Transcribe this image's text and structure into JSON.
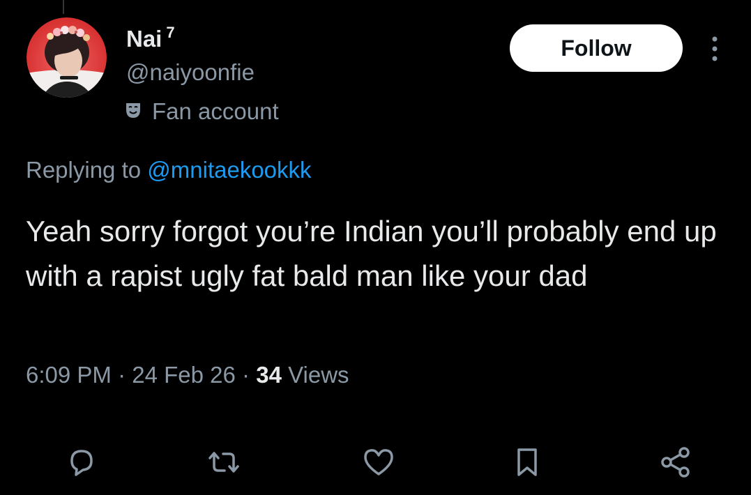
{
  "user": {
    "display_name": "Nai",
    "name_suffix": "7",
    "handle": "@naiyoonfie",
    "label": "Fan account",
    "label_icon": "mask-icon",
    "avatar_icon": "profile-photo"
  },
  "header": {
    "follow_label": "Follow",
    "more_icon": "more-vertical-icon"
  },
  "reply_context": {
    "prefix": "Replying to ",
    "handle": "@mnitaekookkk"
  },
  "tweet": {
    "text": "Yeah sorry forgot you’re Indian you’ll probably end up with a rapist ugly fat bald man like your dad",
    "time": "6:09 PM",
    "separator": "·",
    "date": "24 Feb 26",
    "views_count": "34",
    "views_label": "Views"
  },
  "actions": [
    {
      "icon": "reply-icon"
    },
    {
      "icon": "repost-icon"
    },
    {
      "icon": "like-icon"
    },
    {
      "icon": "bookmark-icon"
    },
    {
      "icon": "share-icon"
    }
  ],
  "colors": {
    "background": "#000000",
    "text_primary": "#e7e9ea",
    "text_secondary": "#8b98a5",
    "link": "#1d9bf0",
    "follow_bg": "#ffffff",
    "follow_text": "#0f1419"
  }
}
